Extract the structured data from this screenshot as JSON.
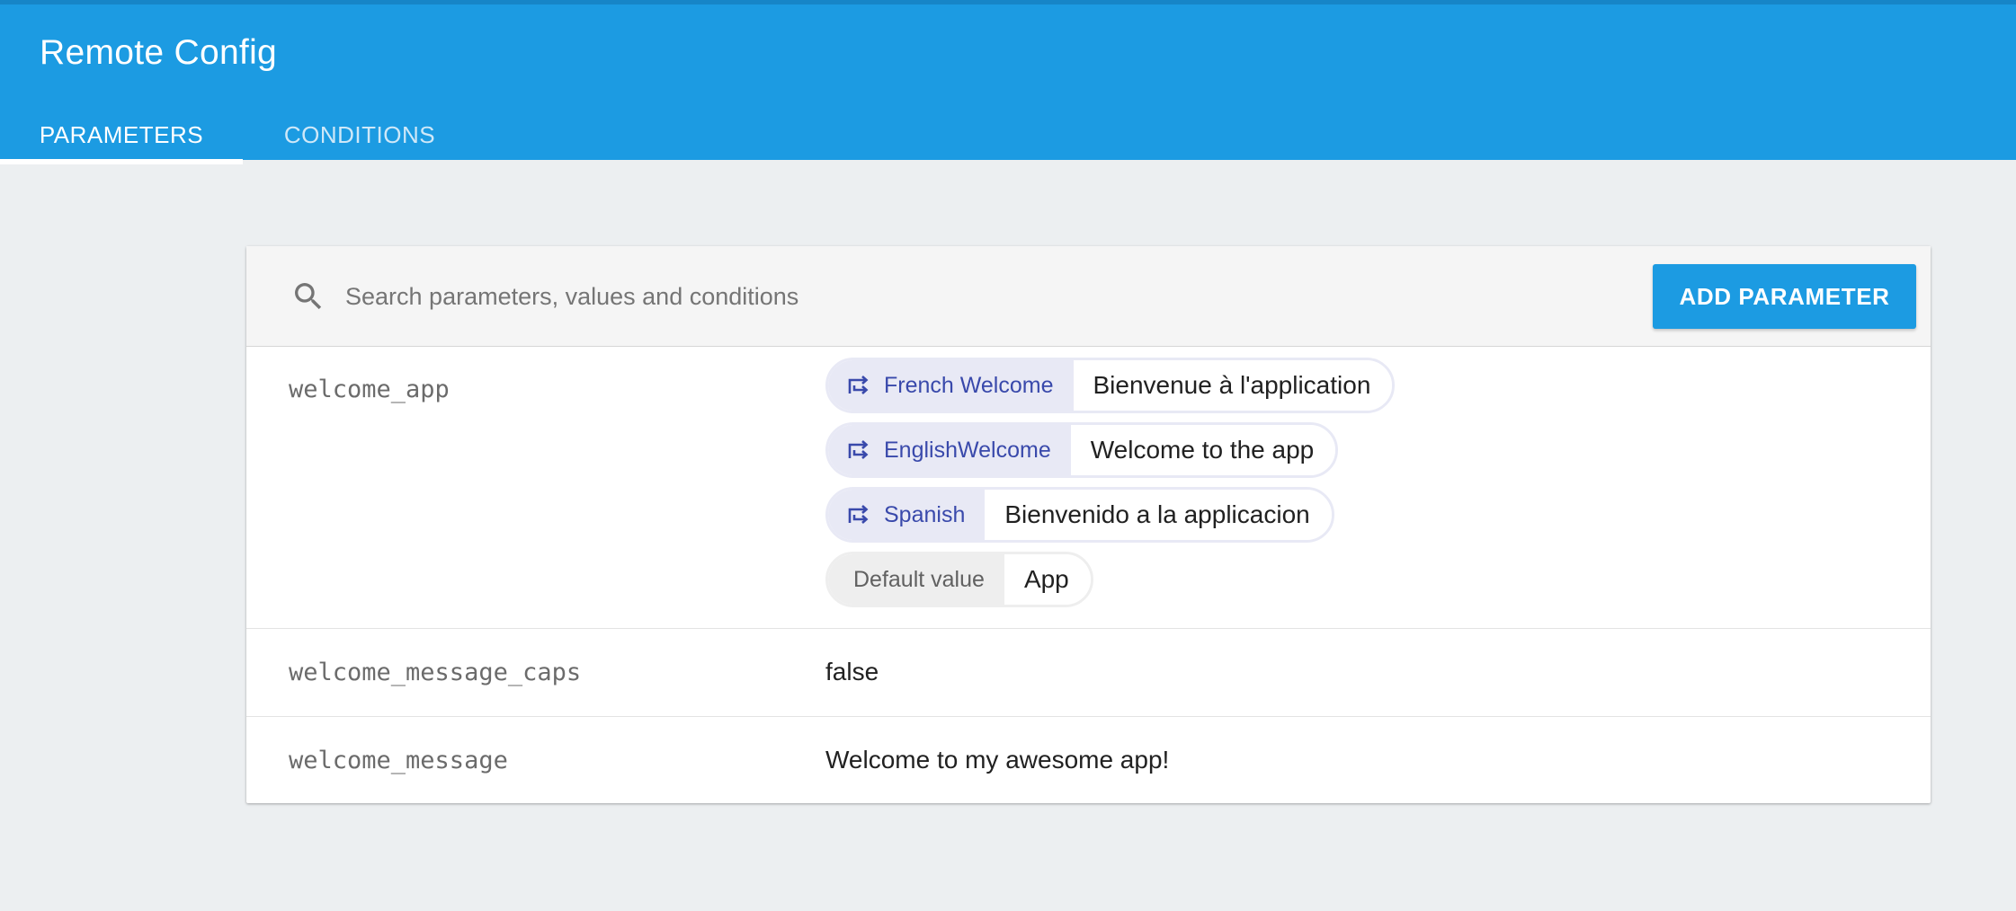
{
  "app": {
    "title": "Remote Config"
  },
  "tabs": [
    {
      "label": "PARAMETERS",
      "active": true
    },
    {
      "label": "CONDITIONS",
      "active": false
    }
  ],
  "toolbar": {
    "search_placeholder": "Search parameters, values and conditions",
    "search_value": "",
    "add_label": "ADD PARAMETER"
  },
  "parameters": [
    {
      "key": "welcome_app",
      "conditional_values": [
        {
          "condition": "French Welcome",
          "value": "Bienvenue à l'application"
        },
        {
          "condition": "EnglishWelcome",
          "value": "Welcome to the app"
        },
        {
          "condition": "Spanish",
          "value": "Bienvenido a la applicacion"
        }
      ],
      "default_label": "Default value",
      "default_value": "App"
    },
    {
      "key": "welcome_message_caps",
      "value": "false"
    },
    {
      "key": "welcome_message",
      "value": "Welcome to my awesome app!"
    }
  ],
  "colors": {
    "header": "#1c9be2",
    "accent": "#1c9be2",
    "condition_text": "#3949ab",
    "condition_bg": "#e8e9f5",
    "page_bg": "#eceff1"
  },
  "icons": {
    "search": "search-icon",
    "condition": "condition-icon"
  }
}
